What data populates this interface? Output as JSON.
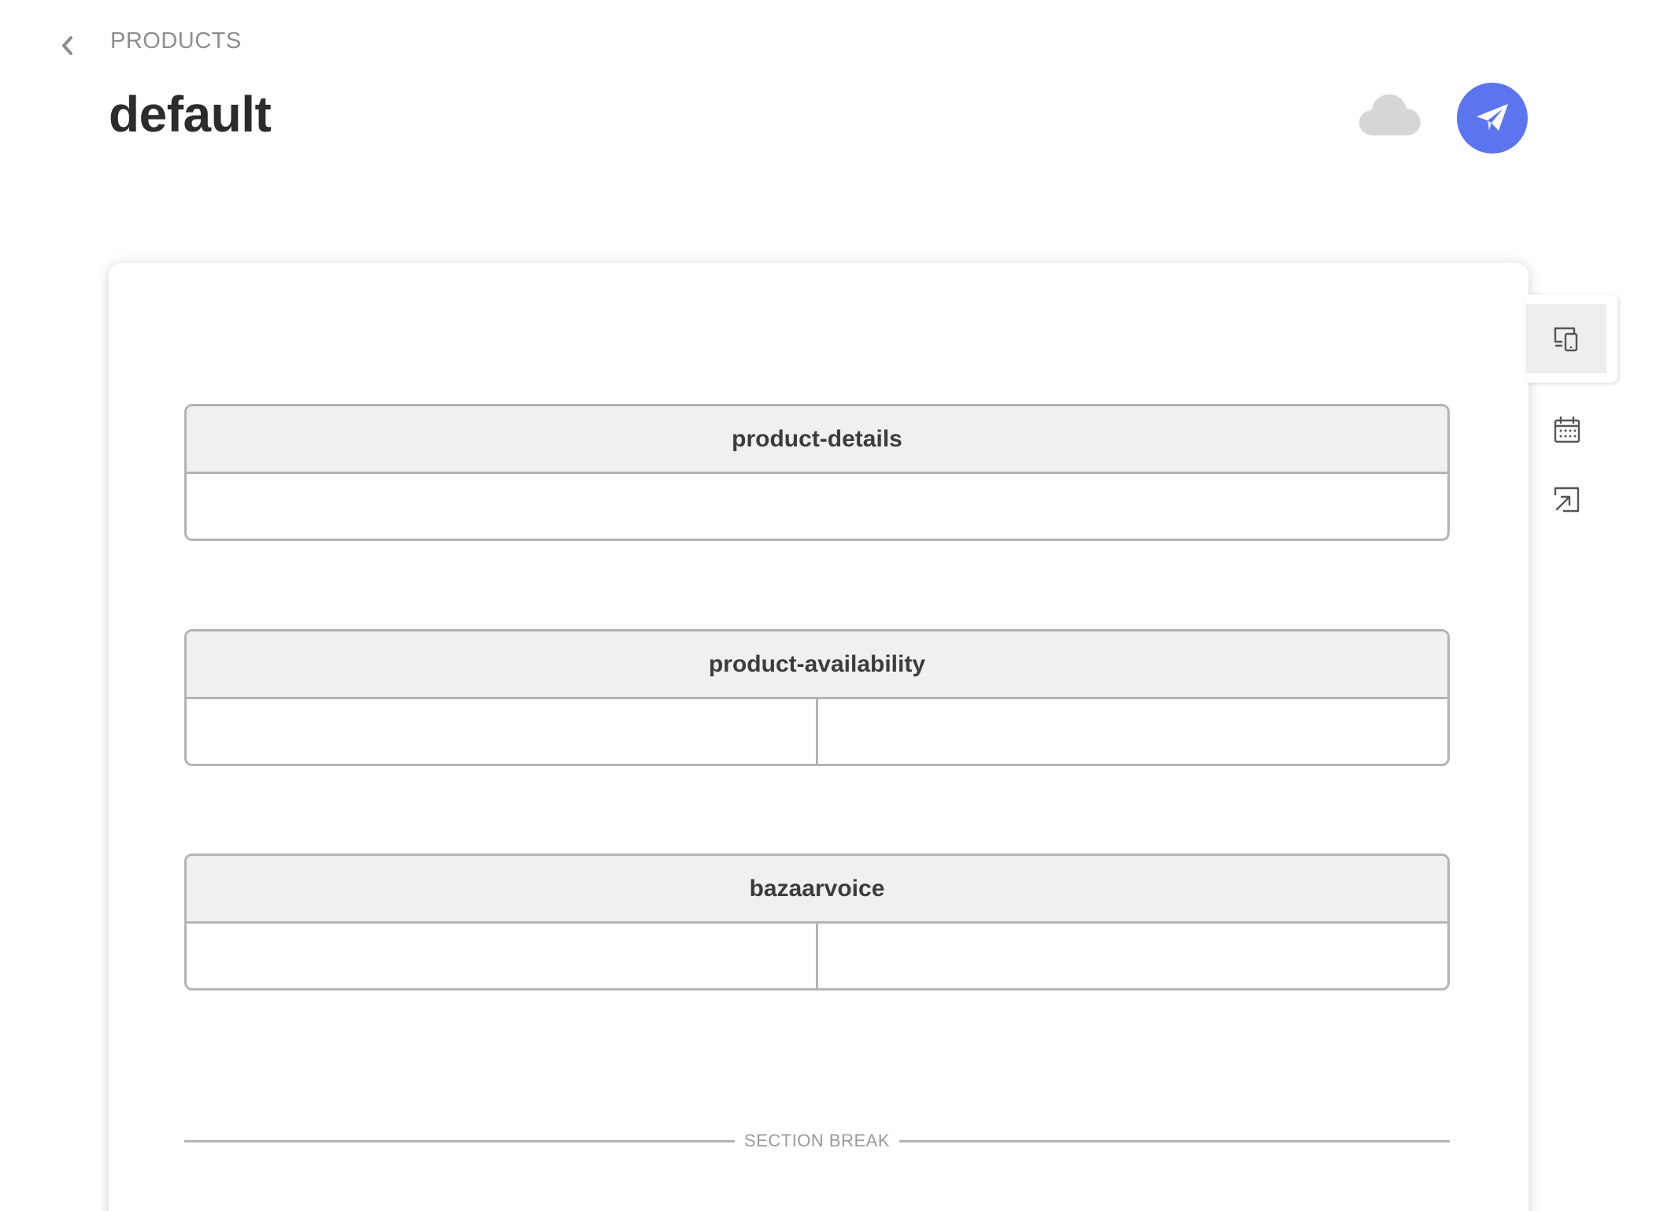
{
  "breadcrumb": {
    "label": "PRODUCTS",
    "back_icon": "chevron-left-icon"
  },
  "title": "default",
  "actions": {
    "cloud_icon": "cloud-icon",
    "publish_icon": "paper-plane-icon",
    "publish_color": "#5b74f0"
  },
  "blocks": [
    {
      "name": "product-details",
      "columns": 1
    },
    {
      "name": "product-availability",
      "columns": 2
    },
    {
      "name": "bazaarvoice",
      "columns": 2
    }
  ],
  "section_break": {
    "label": "SECTION BREAK"
  },
  "rail": {
    "items": [
      {
        "icon": "device-preview-icon",
        "active": true
      },
      {
        "icon": "calendar-icon",
        "active": false
      },
      {
        "icon": "open-external-icon",
        "active": false
      }
    ]
  }
}
